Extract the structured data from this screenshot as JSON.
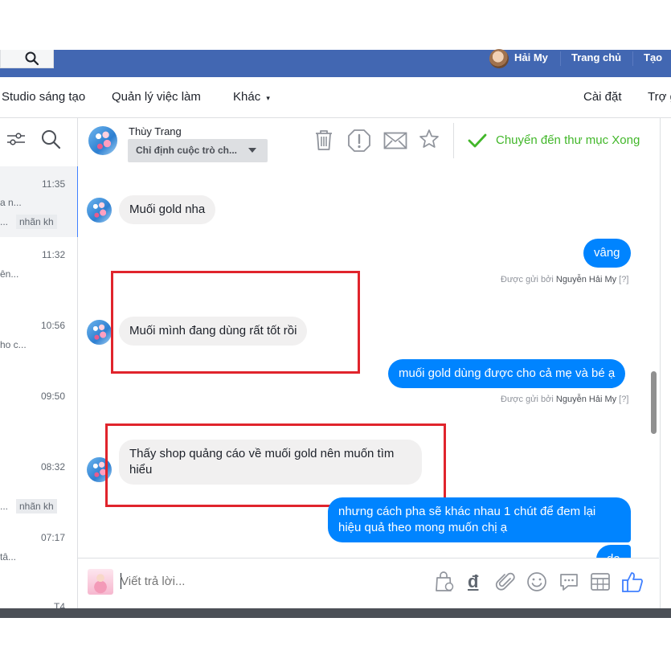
{
  "topbar": {
    "user_name": "Hải My",
    "home": "Trang chủ",
    "create": "Tạo"
  },
  "nav": {
    "items": [
      "Studio sáng tạo",
      "Quản lý việc làm",
      "Khác",
      "Cài đặt",
      "Trợ g"
    ],
    "more_caret": "▾"
  },
  "conversations": [
    {
      "time": "11:35",
      "snippet": "a n...",
      "tag": "nhãn kh",
      "tag_prefix": "..."
    },
    {
      "time": "11:32",
      "snippet": "ên..."
    },
    {
      "time": "10:56",
      "snippet": "ho c..."
    },
    {
      "time": "09:50"
    },
    {
      "time": "08:32",
      "tag": "nhãn kh",
      "tag_prefix": "..."
    },
    {
      "time": "07:17",
      "snippet": "tâ..."
    },
    {
      "time": "T4"
    }
  ],
  "header": {
    "contact_name": "Thùy Trang",
    "assign_label": "Chỉ định cuộc trò ch...",
    "move_done": "Chuyển đến thư mục Xong"
  },
  "messages": [
    {
      "side": "in",
      "text": "Muối gold nha"
    },
    {
      "side": "out",
      "text": "vâng",
      "sent_by_prefix": "Được gửi bởi",
      "sent_by": "Nguyễn Hải My",
      "help": "[?]"
    },
    {
      "side": "in",
      "text": "Muối mình  đang dùng rất tốt rồi"
    },
    {
      "side": "out",
      "text": "muối gold dùng được cho cả mẹ và bé ạ",
      "sent_by_prefix": "Được gửi bởi",
      "sent_by": "Nguyễn Hải My",
      "help": "[?]"
    },
    {
      "side": "in",
      "text": "Thấy shop quảng cáo về muối gold nên muốn tìm hiểu"
    },
    {
      "side": "out",
      "text": "nhưng cách pha sẽ khác nhau 1 chút để đem lại hiệu quả theo mong muốn chị ạ"
    },
    {
      "side": "out",
      "text": "dạ"
    }
  ],
  "composer": {
    "placeholder": "Viết trả lời...",
    "currency_symbol": "đ"
  },
  "colors": {
    "facebook_blue": "#4267b2",
    "messenger_blue": "#0084ff",
    "incoming_bubble": "#f1f0f0",
    "highlight_red": "#e0242c",
    "done_green": "#42b72a"
  }
}
